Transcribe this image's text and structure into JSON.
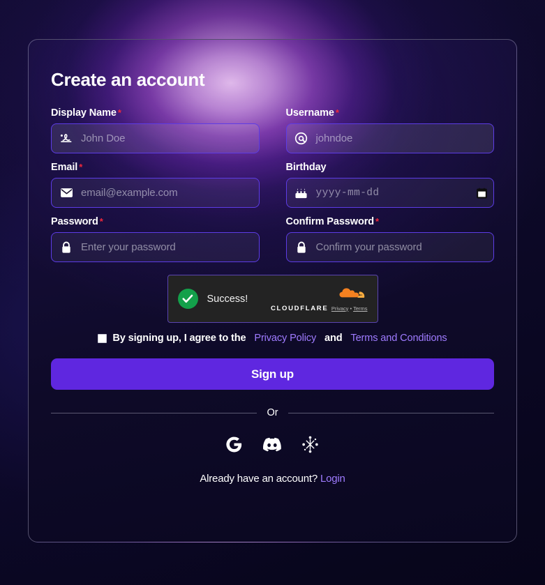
{
  "card": {
    "title": "Create an account"
  },
  "fields": {
    "display_name": {
      "label": "Display Name",
      "required": "*",
      "placeholder": "John Doe",
      "value": "",
      "icon": "signature-icon"
    },
    "username": {
      "label": "Username",
      "required": "*",
      "placeholder": "johndoe",
      "value": "",
      "icon": "at-sign-icon"
    },
    "email": {
      "label": "Email",
      "required": "*",
      "placeholder": "email@example.com",
      "value": "",
      "icon": "envelope-icon"
    },
    "birthday": {
      "label": "Birthday",
      "required": "",
      "placeholder": "yyyy-mm-dd",
      "value": "",
      "icon": "birthday-cake-icon",
      "picker_icon": "calendar-icon"
    },
    "password": {
      "label": "Password",
      "required": "*",
      "placeholder": "Enter your password",
      "value": "",
      "icon": "lock-icon"
    },
    "confirm_password": {
      "label": "Confirm Password",
      "required": "*",
      "placeholder": "Confirm your password",
      "value": "",
      "icon": "lock-icon"
    }
  },
  "turnstile": {
    "status": "Success!",
    "check_icon": "check-circle-icon",
    "brand": "CLOUDFLARE",
    "logo_icon": "cloudflare-cloud-icon",
    "privacy_link": "Privacy",
    "separator": "•",
    "terms_link": "Terms"
  },
  "terms": {
    "checkbox_checked": false,
    "text_before": "By signing up, I agree to the",
    "privacy_link": "Privacy Policy",
    "conjunction": "and",
    "terms_link": "Terms and Conditions"
  },
  "submit": {
    "label": "Sign up"
  },
  "divider": {
    "label": "Or"
  },
  "socials": [
    {
      "name": "google",
      "icon": "google-icon"
    },
    {
      "name": "discord",
      "icon": "discord-icon"
    },
    {
      "name": "starburst",
      "icon": "starburst-icon"
    }
  ],
  "footer": {
    "text": "Already have an account?",
    "login_link": "Login"
  },
  "colors": {
    "accent": "#5f27e0",
    "input_border": "#5d3ce6",
    "link": "#9f7bff",
    "required": "#f0283c",
    "success": "#13a04a",
    "cloudflare_orange": "#f48120",
    "background": "#0e0a2a"
  }
}
